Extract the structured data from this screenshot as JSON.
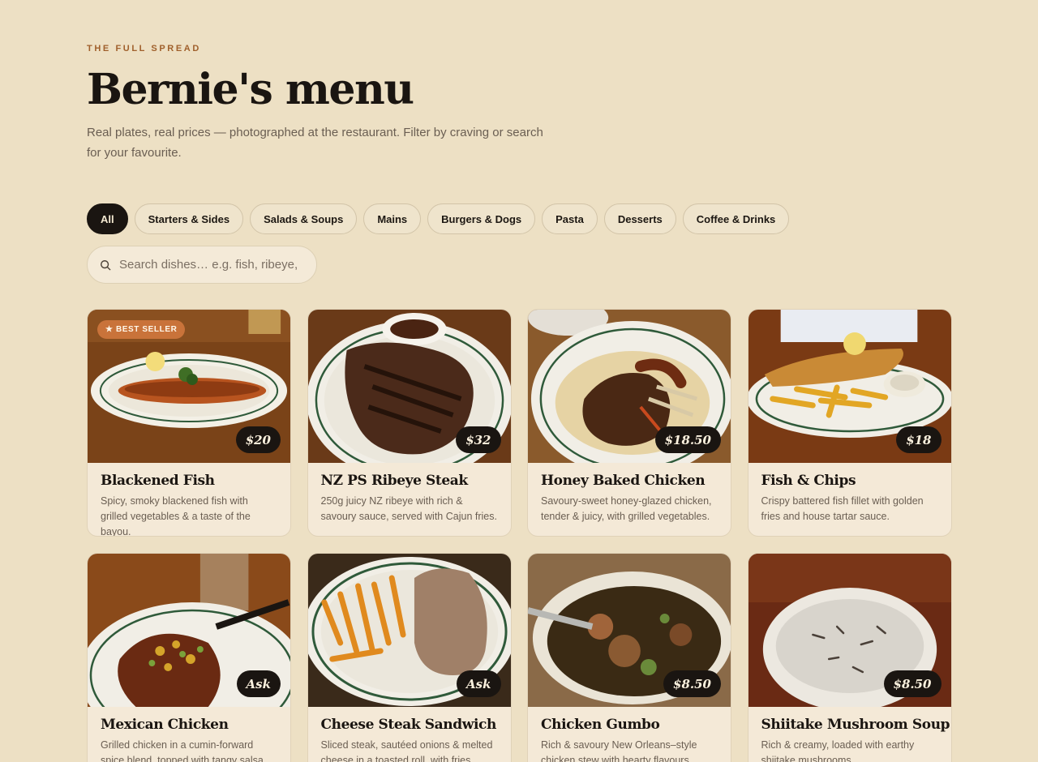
{
  "header": {
    "eyebrow": "THE FULL SPREAD",
    "title": "Bernie's menu",
    "subtitle": "Real plates, real prices — photographed at the restaurant. Filter by craving or search for your favourite."
  },
  "filters": [
    {
      "label": "All",
      "active": true
    },
    {
      "label": "Starters & Sides",
      "active": false
    },
    {
      "label": "Salads & Soups",
      "active": false
    },
    {
      "label": "Mains",
      "active": false
    },
    {
      "label": "Burgers & Dogs",
      "active": false
    },
    {
      "label": "Pasta",
      "active": false
    },
    {
      "label": "Desserts",
      "active": false
    },
    {
      "label": "Coffee & Drinks",
      "active": false
    }
  ],
  "search": {
    "placeholder": "Search dishes… e.g. fish, ribeye,",
    "value": "",
    "icon": "search-icon"
  },
  "colors": {
    "background": "#ede0c4",
    "accent": "#c9733a",
    "dark": "#1a1511",
    "card": "#f4e9d7"
  },
  "menu": [
    {
      "name": "Blackened Fish",
      "price": "$20",
      "badge": "★ BEST SELLER",
      "description": "Spicy, smoky blackened fish with grilled vegetables & a taste of the bayou."
    },
    {
      "name": "NZ PS Ribeye Steak",
      "price": "$32",
      "badge": "",
      "description": "250g juicy NZ ribeye with rich & savoury sauce, served with Cajun fries."
    },
    {
      "name": "Honey Baked Chicken",
      "price": "$18.50",
      "badge": "",
      "description": "Savoury-sweet honey-glazed chicken, tender & juicy, with grilled vegetables."
    },
    {
      "name": "Fish & Chips",
      "price": "$18",
      "badge": "",
      "description": "Crispy battered fish fillet with golden fries and house tartar sauce."
    },
    {
      "name": "Mexican Chicken",
      "price": "Ask",
      "badge": "",
      "description": "Grilled chicken in a cumin-forward spice blend, topped with tangy salsa."
    },
    {
      "name": "Cheese Steak Sandwich",
      "price": "Ask",
      "badge": "",
      "description": "Sliced steak, sautéed onions & melted cheese in a toasted roll, with fries."
    },
    {
      "name": "Chicken Gumbo",
      "price": "$8.50",
      "badge": "",
      "description": "Rich & savoury New Orleans–style chicken stew with hearty flavours."
    },
    {
      "name": "Shiitake Mushroom Soup",
      "price": "$8.50",
      "badge": "",
      "description": "Rich & creamy, loaded with earthy shiitake mushrooms."
    }
  ]
}
